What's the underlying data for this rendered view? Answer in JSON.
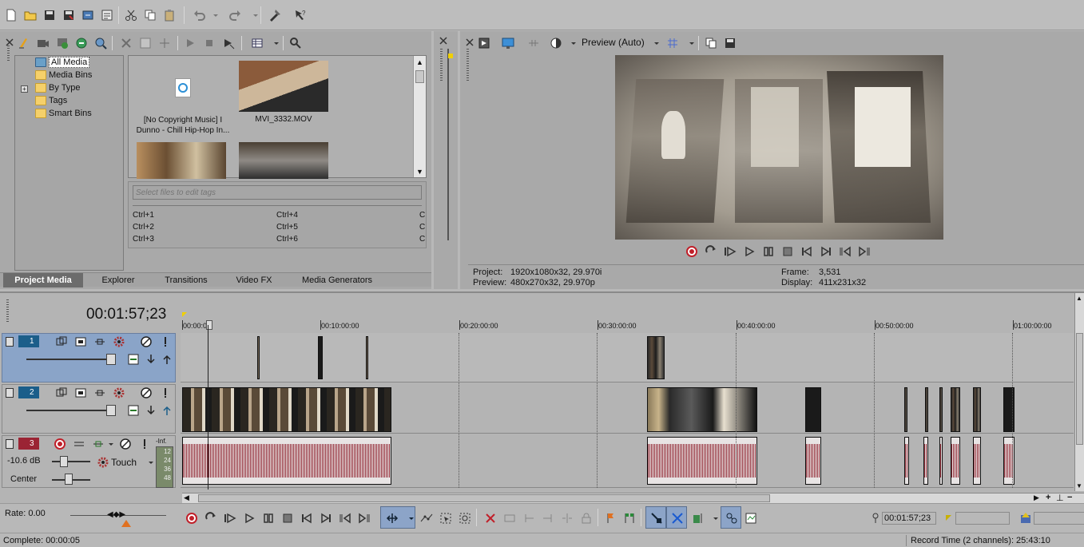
{
  "explorer": {
    "tree": [
      "All Media",
      "Media Bins",
      "By Type",
      "Tags",
      "Smart Bins"
    ],
    "media": [
      {
        "name": "[No Copyright Music] I Dunno - Chill Hip-Hop In...",
        "kind": "audio"
      },
      {
        "name": "MVI_3332.MOV",
        "kind": "video"
      }
    ],
    "tags_placeholder": "Select files to edit tags",
    "shortcuts_col1": [
      "Ctrl+1",
      "Ctrl+2",
      "Ctrl+3"
    ],
    "shortcuts_col2": [
      "Ctrl+4",
      "Ctrl+5",
      "Ctrl+6"
    ],
    "shortcuts_col3": [
      "C",
      "C",
      "C"
    ],
    "tabs": [
      "Project Media",
      "Explorer",
      "Transitions",
      "Video FX",
      "Media Generators"
    ]
  },
  "preview": {
    "mode_label": "Preview (Auto)",
    "project_label": "Project:",
    "project_value": "1920x1080x32, 29.970i",
    "preview_label": "Preview:",
    "preview_value": "480x270x32, 29.970p",
    "frame_label": "Frame:",
    "frame_value": "3,531",
    "display_label": "Display:",
    "display_value": "411x231x32"
  },
  "timeline": {
    "timecode": "00:01:57;23",
    "ruler": [
      "00:00:00",
      "00:10:00:00",
      "00:20:00:00",
      "00:30:00:00",
      "00:40:00:00",
      "00:50:00:00",
      "01:00:00:00"
    ],
    "tracks": [
      {
        "number": "1",
        "type": "video"
      },
      {
        "number": "2",
        "type": "video"
      },
      {
        "number": "3",
        "type": "audio",
        "volume": "-10.6 dB",
        "pan": "Center",
        "mode": "Touch",
        "meter_top": "-Inf.",
        "meter_scale": [
          "12",
          "24",
          "36",
          "48"
        ]
      }
    ]
  },
  "transport": {
    "rate": "Rate: 0.00",
    "cursor_time": "00:01:57;23"
  },
  "status": {
    "complete": "Complete: 00:00:05",
    "record_time": "Record Time (2 channels): 25:43:10"
  },
  "colors": {
    "accent_track": "#8aa4c8",
    "waveform": "#8e1f2b",
    "record": "#c0202a"
  }
}
